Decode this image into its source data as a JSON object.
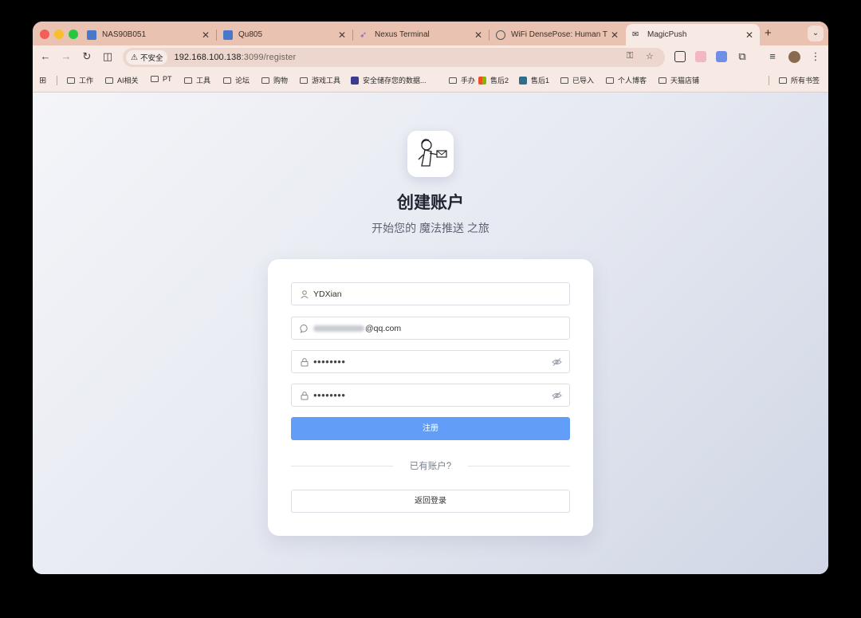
{
  "browser": {
    "tabs": [
      {
        "title": "NAS90B051",
        "favicon": "qnap-icon"
      },
      {
        "title": "Qu805",
        "favicon": "qnap-icon"
      },
      {
        "title": "Nexus Terminal",
        "favicon": "terminal-icon"
      },
      {
        "title": "WiFi DensePose: Human Tra",
        "favicon": "globe-icon"
      },
      {
        "title": "MagicPush",
        "favicon": "magicpush-icon",
        "active": true
      }
    ],
    "security_label": "不安全",
    "url_host": "192.168.100.138",
    "url_path": ":3099/register"
  },
  "bookmarks": [
    {
      "label": "工作",
      "type": "folder"
    },
    {
      "label": "AI相关",
      "type": "folder"
    },
    {
      "label": "PT",
      "type": "folder"
    },
    {
      "label": "工具",
      "type": "folder"
    },
    {
      "label": "论坛",
      "type": "folder"
    },
    {
      "label": "购物",
      "type": "folder"
    },
    {
      "label": "游戏工具",
      "type": "folder"
    },
    {
      "label": "安全储存您的数据...",
      "type": "link"
    },
    {
      "label": "手办",
      "type": "folder"
    },
    {
      "label": "售后2",
      "type": "link"
    },
    {
      "label": "售后1",
      "type": "link"
    },
    {
      "label": "已导入",
      "type": "folder"
    },
    {
      "label": "个人博客",
      "type": "folder"
    },
    {
      "label": "天猫店铺",
      "type": "folder"
    },
    {
      "label": "所有书签",
      "type": "folder"
    }
  ],
  "register": {
    "heading": "创建账户",
    "subheading": "开始您的 魔法推送 之旅",
    "username_value": "YDXian",
    "email_value": "@qq.com",
    "password_mask": "••••••••",
    "confirm_mask": "••••••••",
    "submit_label": "注册",
    "divider_text": "已有账户?",
    "back_label": "返回登录"
  },
  "colors": {
    "tabstrip": "#e9c2b1",
    "toolbar": "#f7e9e3",
    "primary_button": "#629ef8"
  }
}
